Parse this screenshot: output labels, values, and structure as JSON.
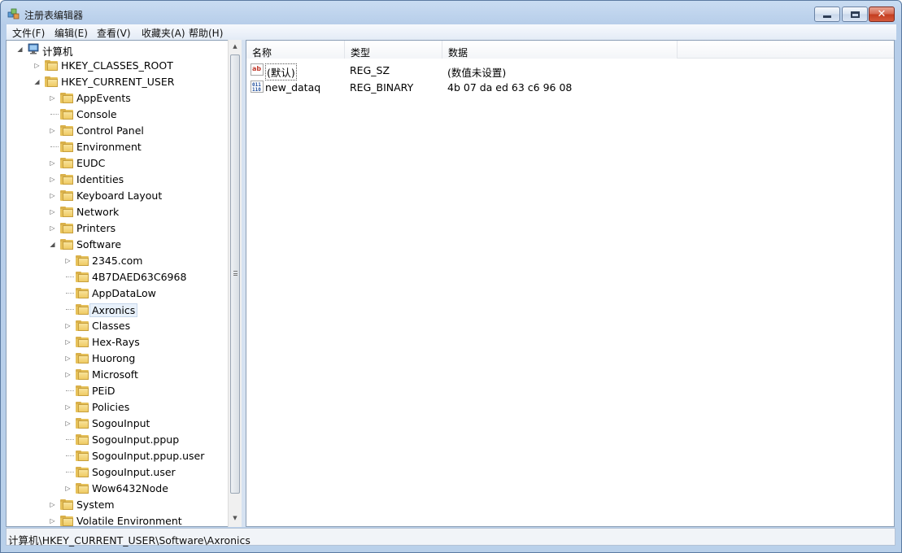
{
  "window": {
    "title": "注册表编辑器"
  },
  "menu": [
    "文件(F)",
    "编辑(E)",
    "查看(V)",
    "收藏夹(A)",
    "帮助(H)"
  ],
  "tree": {
    "root": "计算机",
    "items": [
      {
        "label": "HKEY_CLASSES_ROOT",
        "expander": "collapsed"
      },
      {
        "label": "HKEY_CURRENT_USER",
        "expander": "expanded"
      },
      {
        "label": "AppEvents",
        "expander": "collapsed"
      },
      {
        "label": "Console",
        "expander": "none"
      },
      {
        "label": "Control Panel",
        "expander": "collapsed"
      },
      {
        "label": "Environment",
        "expander": "none"
      },
      {
        "label": "EUDC",
        "expander": "collapsed"
      },
      {
        "label": "Identities",
        "expander": "collapsed"
      },
      {
        "label": "Keyboard Layout",
        "expander": "collapsed"
      },
      {
        "label": "Network",
        "expander": "collapsed"
      },
      {
        "label": "Printers",
        "expander": "collapsed"
      },
      {
        "label": "Software",
        "expander": "expanded"
      },
      {
        "label": "2345.com",
        "expander": "collapsed"
      },
      {
        "label": "4B7DAED63C6968",
        "expander": "none"
      },
      {
        "label": "AppDataLow",
        "expander": "none"
      },
      {
        "label": "Axronics",
        "expander": "none",
        "selected": true
      },
      {
        "label": "Classes",
        "expander": "collapsed"
      },
      {
        "label": "Hex-Rays",
        "expander": "collapsed"
      },
      {
        "label": "Huorong",
        "expander": "collapsed"
      },
      {
        "label": "Microsoft",
        "expander": "collapsed"
      },
      {
        "label": "PEiD",
        "expander": "none"
      },
      {
        "label": "Policies",
        "expander": "collapsed"
      },
      {
        "label": "SogouInput",
        "expander": "collapsed"
      },
      {
        "label": "SogouInput.ppup",
        "expander": "none"
      },
      {
        "label": "SogouInput.ppup.user",
        "expander": "none"
      },
      {
        "label": "SogouInput.user",
        "expander": "none"
      },
      {
        "label": "Wow6432Node",
        "expander": "collapsed"
      },
      {
        "label": "System",
        "expander": "collapsed"
      },
      {
        "label": "Volatile Environment",
        "expander": "collapsed"
      }
    ]
  },
  "list": {
    "columns": [
      "名称",
      "类型",
      "数据"
    ],
    "rows": [
      {
        "name": "(默认)",
        "type": "REG_SZ",
        "data": "(数值未设置)",
        "icon": "string-value-icon"
      },
      {
        "name": "new_dataq",
        "type": "REG_BINARY",
        "data": "4b 07 da ed 63 c6 96 08",
        "icon": "binary-value-icon"
      }
    ]
  },
  "status": {
    "path": "计算机\\HKEY_CURRENT_USER\\Software\\Axronics"
  }
}
